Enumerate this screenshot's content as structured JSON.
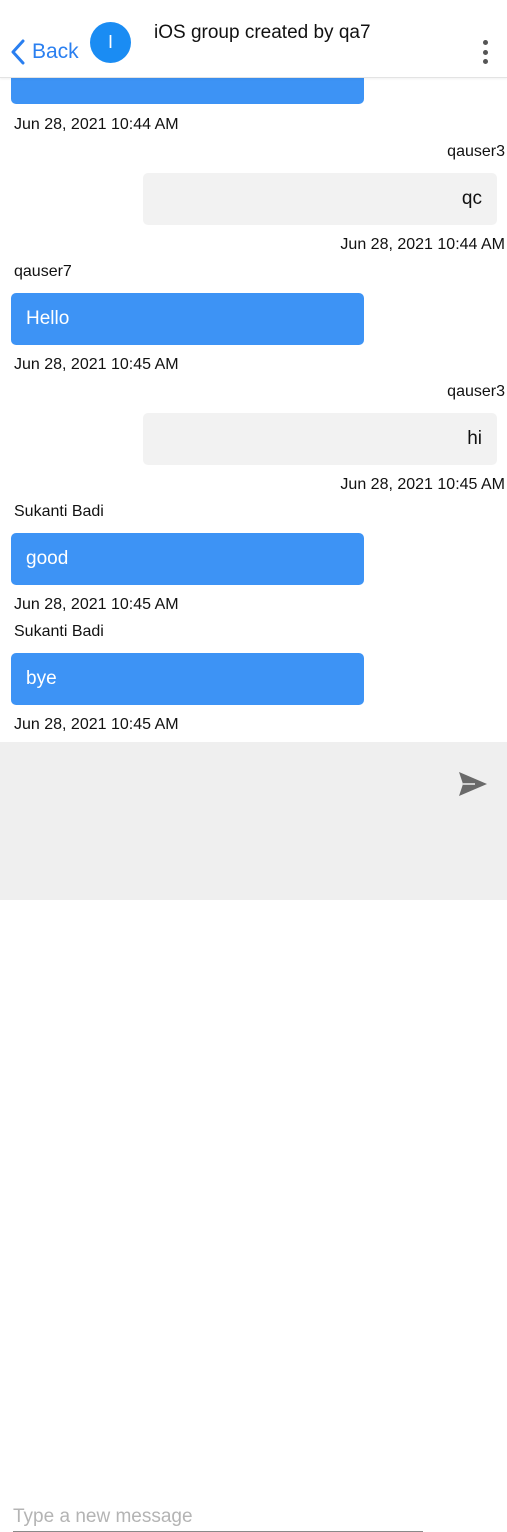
{
  "header": {
    "back_label": "Back",
    "avatar_initial": "I",
    "title": "iOS group created by qa7"
  },
  "messages": [
    {
      "direction": "in",
      "sender": "",
      "text": "",
      "timestamp": "Jun 28, 2021 10:44 AM"
    },
    {
      "direction": "out",
      "sender": "qauser3",
      "text": "qc",
      "timestamp": "Jun 28, 2021 10:44 AM"
    },
    {
      "direction": "in",
      "sender": "qauser7",
      "text": "Hello",
      "timestamp": "Jun 28, 2021 10:45 AM"
    },
    {
      "direction": "out",
      "sender": "qauser3",
      "text": "hi",
      "timestamp": "Jun 28, 2021 10:45 AM"
    },
    {
      "direction": "in",
      "sender": "Sukanti Badi",
      "text": "good",
      "timestamp": "Jun 28, 2021 10:45 AM"
    },
    {
      "direction": "in",
      "sender": "Sukanti Badi",
      "text": "bye",
      "timestamp": "Jun 28, 2021 10:45 AM"
    }
  ],
  "composer": {
    "placeholder": "Type a new message",
    "value": ""
  },
  "colors": {
    "accent": "#2a7ff0",
    "incoming_bubble": "#3d93f5",
    "outgoing_bubble": "#f2f2f2",
    "composer_bg": "#efefef"
  },
  "icons": {
    "back": "chevron-left-icon",
    "menu": "more-vertical-icon",
    "send": "send-icon"
  }
}
